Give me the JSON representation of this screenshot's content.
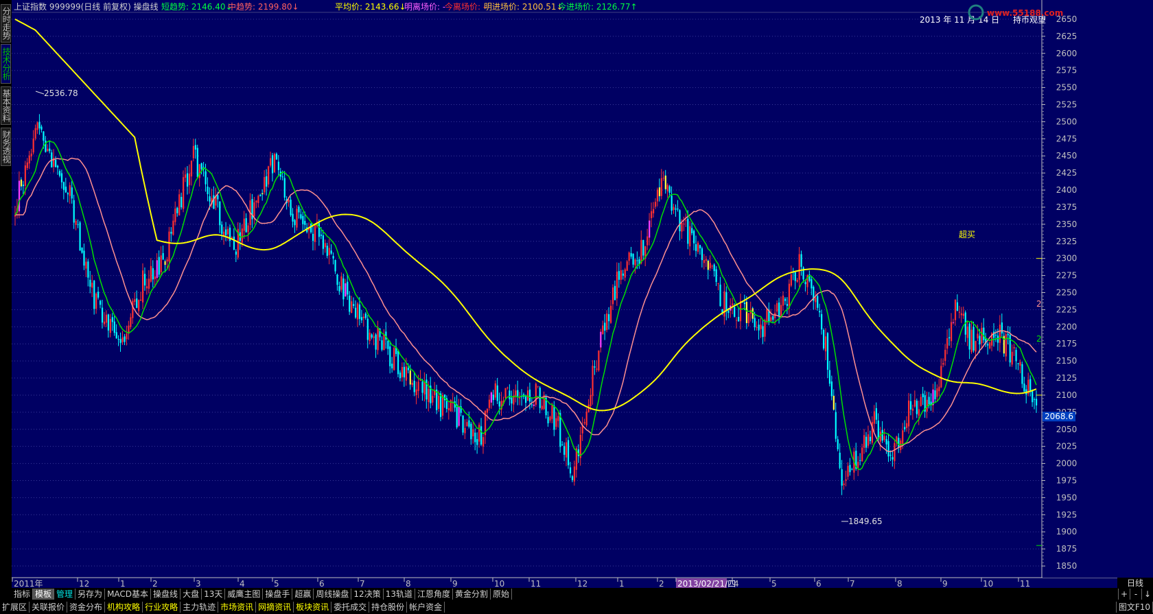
{
  "side_tabs": [
    {
      "label": "分时走势",
      "active": false
    },
    {
      "label": "技术分析",
      "active": true
    },
    {
      "label": "基本资料",
      "active": false
    },
    {
      "label": "财务透视",
      "active": false
    }
  ],
  "header": {
    "stock_title": "上证指数 999999(日线 前复权) 操盘线",
    "indicators": [
      {
        "label": "短趋势: 2146.40",
        "arrow": "↓",
        "color": "#00ff40"
      },
      {
        "label": "中趋势: 2199.80",
        "arrow": "↓",
        "color": "#ff6060"
      },
      {
        "label": "平均价: 2143.66",
        "arrow": "↓",
        "color": "#ffff00"
      },
      {
        "label": "明离场价: -",
        "arrow": "",
        "color": "#ff60ff"
      },
      {
        "label": "今离场价: -",
        "arrow": "",
        "color": "#ff3030"
      },
      {
        "label": "明进场价: 2100.51",
        "arrow": "↓",
        "color": "#ffc040"
      },
      {
        "label": "今进场价: 2126.77",
        "arrow": "↑",
        "color": "#00ff40"
      }
    ],
    "date": "2013 年 11 月 14 日",
    "status": "持币观望",
    "watermark": "www.55188.com"
  },
  "price_axis": {
    "ticks": [
      2650,
      2625,
      2600,
      2575,
      2550,
      2525,
      2500,
      2475,
      2450,
      2425,
      2400,
      2375,
      2350,
      2325,
      2300,
      2275,
      2250,
      2225,
      2200,
      2175,
      2150,
      2125,
      2100,
      2075,
      2050,
      2025,
      2000,
      1975,
      1950,
      1925,
      1900,
      1875,
      1850
    ],
    "current_price": "2068.6"
  },
  "annotations": {
    "high_label": "2536.78",
    "low_label": "1849.65",
    "overbought_label": "超买",
    "right_marker_1": "2",
    "right_marker_2": "2"
  },
  "time_axis": {
    "labels": [
      "2011年",
      "12",
      "1",
      "2",
      "3",
      "4",
      "5",
      "6",
      "7",
      "8",
      "9",
      "10",
      "11",
      "12",
      "1",
      "2",
      "2013/02/21/四",
      "4",
      "5",
      "6",
      "7",
      "8",
      "9",
      "10",
      "11"
    ],
    "period": "日线"
  },
  "toolbar_row1": [
    {
      "label": "指标",
      "style": ""
    },
    {
      "label": "模板",
      "style": "active"
    },
    {
      "label": "管理",
      "style": "cyan"
    },
    {
      "label": "另存为",
      "style": ""
    },
    {
      "label": "MACD基本",
      "style": ""
    },
    {
      "label": "操盘线",
      "style": ""
    },
    {
      "label": "大盘",
      "style": ""
    },
    {
      "label": "13天",
      "style": ""
    },
    {
      "label": "威鹰主图",
      "style": ""
    },
    {
      "label": "操盘手",
      "style": ""
    },
    {
      "label": "超赢",
      "style": ""
    },
    {
      "label": "周线操盘",
      "style": ""
    },
    {
      "label": "12决策",
      "style": ""
    },
    {
      "label": "13轨道",
      "style": ""
    },
    {
      "label": "江恩角度",
      "style": ""
    },
    {
      "label": "黄金分割",
      "style": ""
    },
    {
      "label": "原始",
      "style": ""
    }
  ],
  "toolbar_row2": [
    {
      "label": "扩展区",
      "style": ""
    },
    {
      "label": "关联报价",
      "style": ""
    },
    {
      "label": "资金分布",
      "style": ""
    },
    {
      "label": "机构攻略",
      "style": "yellow"
    },
    {
      "label": "行业攻略",
      "style": "yellow"
    },
    {
      "label": "主力轨迹",
      "style": ""
    },
    {
      "label": "市场资讯",
      "style": "yellow"
    },
    {
      "label": "网摘资讯",
      "style": "yellow"
    },
    {
      "label": "板块资讯",
      "style": "yellow"
    },
    {
      "label": "委托成交",
      "style": ""
    },
    {
      "label": "持仓股份",
      "style": ""
    },
    {
      "label": "帐户资金",
      "style": ""
    }
  ],
  "row1_buttons": [
    "+",
    "-",
    "↓"
  ],
  "row2_right_label": "图文F10",
  "colors": {
    "background": "#000063",
    "axis": "#c0c0c0",
    "up_candle": "#ff3030",
    "down_candle": "#00ffff",
    "short_trend": "#00e000",
    "mid_trend": "#ff9090",
    "average_price": "#ffff00"
  }
}
